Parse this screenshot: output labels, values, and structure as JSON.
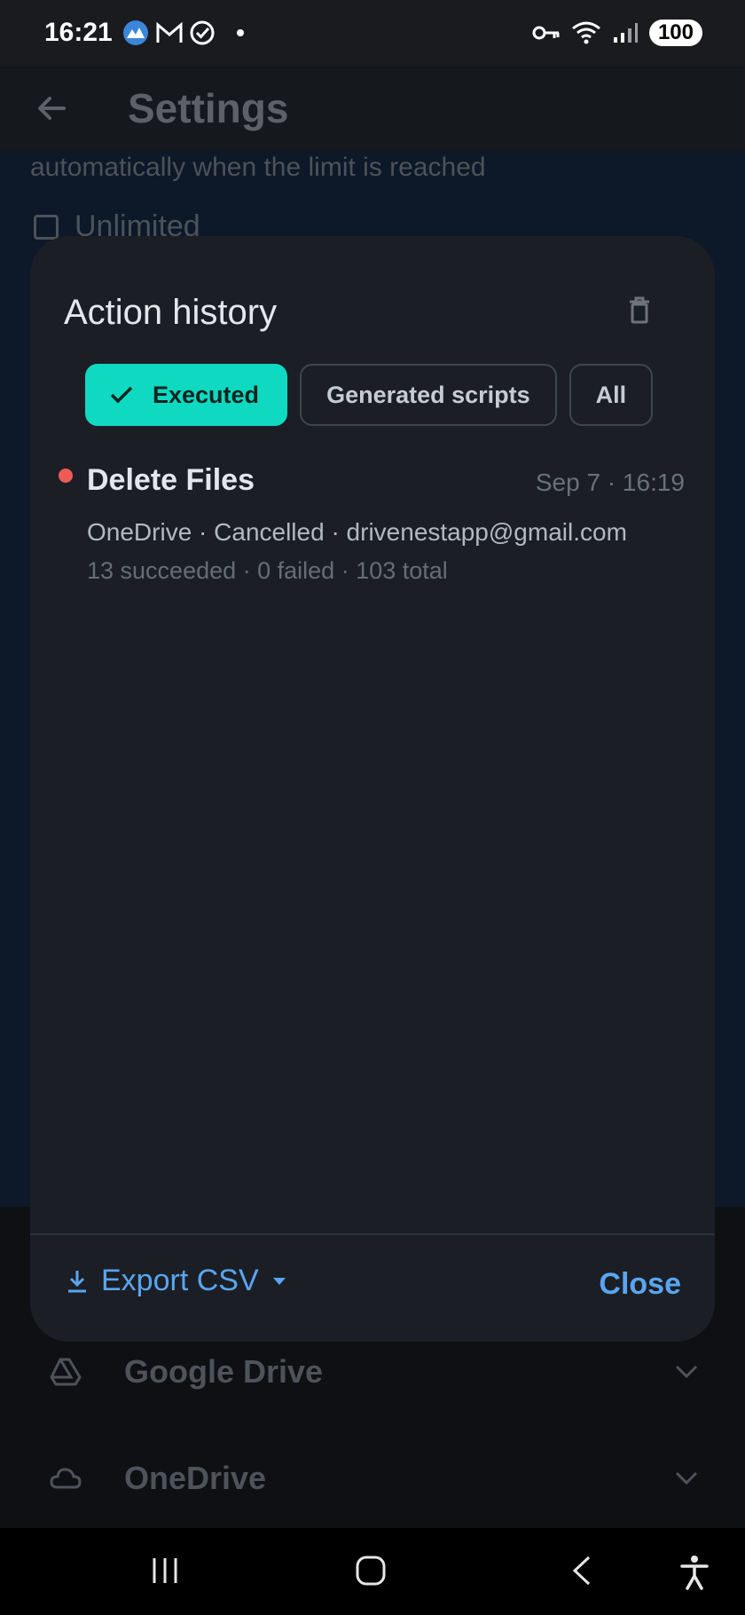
{
  "status_bar": {
    "time": "16:21",
    "battery": "100",
    "icons": [
      "app-icon",
      "gmail-icon",
      "check-circle-icon",
      "notification-dot",
      "vpn-key-icon",
      "wifi-icon",
      "signal-icon"
    ]
  },
  "header": {
    "title": "Settings",
    "back_icon": "arrow-left-icon"
  },
  "background": {
    "description_text": "automatically when the limit is reached",
    "checkbox_label": "Unlimited",
    "drives": [
      {
        "label": "Google Drive",
        "icon": "google-drive-icon"
      },
      {
        "label": "OneDrive",
        "icon": "cloud-icon"
      }
    ]
  },
  "dialog": {
    "title": "Action history",
    "delete_icon": "trash-icon",
    "filters": [
      {
        "label": "Executed",
        "selected": true
      },
      {
        "label": "Generated scripts",
        "selected": false
      },
      {
        "label": "All",
        "selected": false
      }
    ],
    "items": [
      {
        "title": "Delete Files",
        "time": "Sep 7 · 16:19",
        "meta": "OneDrive · Cancelled · drivenestapp@gmail.com",
        "stats": "13 succeeded · 0 failed · 103 total",
        "status_color": "#ec5b56"
      }
    ],
    "export_label": "Export CSV",
    "close_label": "Close"
  },
  "colors": {
    "accent": "#0fd9c1",
    "link": "#5aa5f0",
    "error": "#ec5b56"
  }
}
